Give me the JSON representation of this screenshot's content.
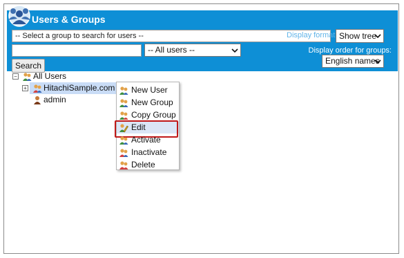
{
  "app": {
    "title": "Users & Groups"
  },
  "filters": {
    "group_placeholder": "-- Select a group to search for users --",
    "display_label": "Display format",
    "show_tree": "Show tree",
    "users_filter": "-- All users --",
    "order_label": "Display order for groups:",
    "order_value": "English names",
    "search_label": "Search"
  },
  "tree": {
    "root_label": "All Users",
    "group_label": "HitachiSample.com",
    "user_label": "admin"
  },
  "context_menu": {
    "items": [
      {
        "label": "New User",
        "icon": "new-user-icon"
      },
      {
        "label": "New Group",
        "icon": "new-group-icon"
      },
      {
        "label": "Copy Group",
        "icon": "copy-group-icon"
      },
      {
        "label": "Edit",
        "icon": "edit-icon",
        "highlighted": true
      },
      {
        "label": "Activate",
        "icon": "activate-icon"
      },
      {
        "label": "Inactivate",
        "icon": "inactivate-icon"
      },
      {
        "label": "Delete",
        "icon": "delete-icon"
      }
    ]
  },
  "colors": {
    "header": "#0e8fd6",
    "highlight": "#c01818",
    "selection": "#c9dcf6"
  }
}
